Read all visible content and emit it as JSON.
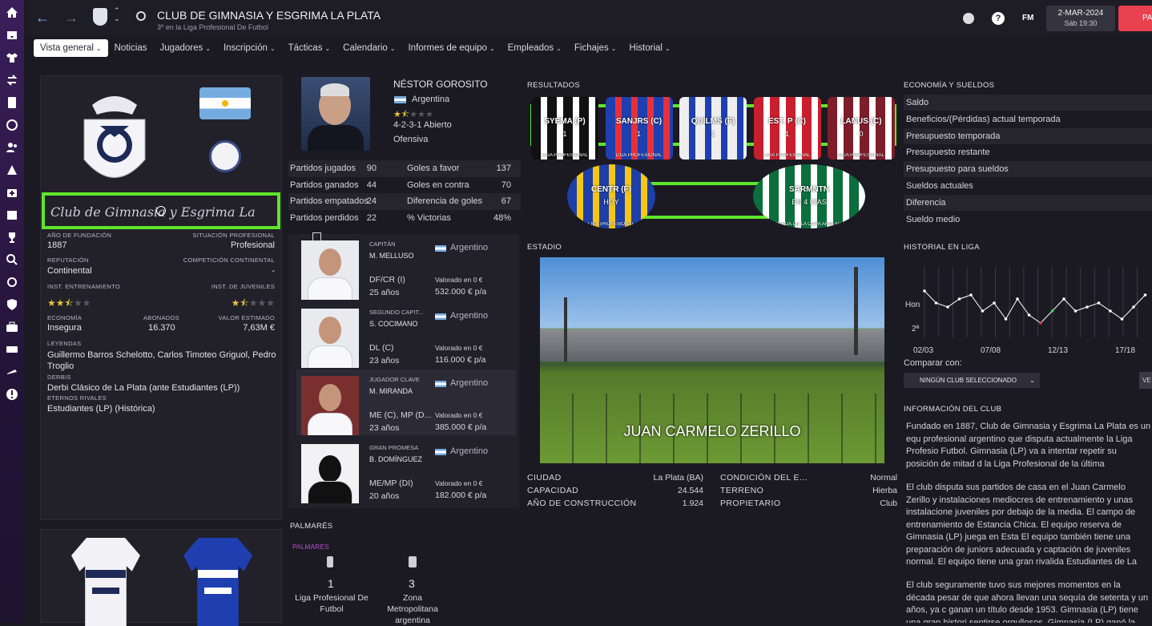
{
  "header": {
    "title": "CLUB DE GIMNASIA Y ESGRIMA LA PLATA",
    "subtitle": "3º en la Liga Profesional De Futbol",
    "date": "2-MAR-2024",
    "time": "Sáb 19:30",
    "fm_label": "FM",
    "continue_label": "PA"
  },
  "tabs": [
    {
      "label": "Vista general",
      "active": true
    },
    {
      "label": "Noticias"
    },
    {
      "label": "Jugadores",
      "caret": true
    },
    {
      "label": "Inscripción",
      "caret": true
    },
    {
      "label": "Tácticas",
      "caret": true
    },
    {
      "label": "Calendario",
      "caret": true
    },
    {
      "label": "Informes de equipo",
      "caret": true
    },
    {
      "label": "Empleados",
      "caret": true
    },
    {
      "label": "Fichajes",
      "caret": true
    },
    {
      "label": "Historial",
      "caret": true
    }
  ],
  "club": {
    "name_script": "Club de Gimnasia y Esgrima La",
    "founded_label": "AÑO DE FUNDACIÓN",
    "founded": "1887",
    "status_label": "SITUACIÓN PROFESIONAL",
    "status": "Profesional",
    "reputation_label": "REPUTACIÓN",
    "reputation": "Continental",
    "continental_label": "COMPETICIÓN CONTINENTAL",
    "continental": "-",
    "training_label": "INST. ENTRENAMIENTO",
    "training_stars": 2.5,
    "youth_label": "INST. DE JUVENILES",
    "youth_stars": 1.5,
    "economy_label": "ECONOMÍA",
    "economy": "Insegura",
    "members_label": "ABONADOS",
    "members": "16.370",
    "value_label": "VALOR ESTIMADO",
    "value": "7,63M €",
    "legends_label": "LEYENDAS",
    "legends": "Guillermo Barros Schelotto, Carlos Timoteo Griguol, Pedro Troglio",
    "derbies_label": "DERBIS",
    "derbies": "Derbi Clásico de La Plata (ante Estudiantes (LP))",
    "rivals_label": "ETERNOS RIVALES",
    "rivals": "Estudiantes (LP) (Histórica)"
  },
  "manager": {
    "name": "NÉSTOR GOROSITO",
    "nation": "Argentina",
    "stars": 1.5,
    "formation": "4-2-3-1 Abierto",
    "style": "Ofensiva"
  },
  "stats": [
    [
      "Partidos jugados",
      "90",
      "Goles a favor",
      "137"
    ],
    [
      "Partidos ganados",
      "44",
      "Goles en contra",
      "70"
    ],
    [
      "Partidos empatados",
      "24",
      "Diferencia de goles",
      "67"
    ],
    [
      "Partidos perdidos",
      "22",
      "% Victorias",
      "48%"
    ]
  ],
  "players": [
    {
      "role": "CAPITÁN",
      "name": "M. MELLUSO",
      "nation": "Argentino",
      "pos": "DF/CR (I)",
      "age": "25 años",
      "value_label": "Valorado en 0 €",
      "wage": "532.000 € p/a"
    },
    {
      "role": "SEGUNDO CAPIT...",
      "name": "S. COCIMANO",
      "nation": "Argentino",
      "pos": "DL (C)",
      "age": "23 años",
      "value_label": "Valorado en 0 €",
      "wage": "116.000 € p/a"
    },
    {
      "role": "JUGADOR CLAVE",
      "name": "M. MIRANDA",
      "nation": "Argentino",
      "pos": "ME (C), MP (D...",
      "age": "23 años",
      "value_label": "Valorado en 0 €",
      "wage": "385.000 € p/a"
    },
    {
      "role": "GRAN PROMESA",
      "name": "B. DOMÍNGUEZ",
      "nation": "Argentino",
      "pos": "ME/MP (DI)",
      "age": "20 años",
      "value_label": "Valorado en 0 €",
      "wage": "182.000 € p/a"
    }
  ],
  "palmares": {
    "title": "PALMARÉS",
    "subtitle": "PALMARÉS",
    "items": [
      {
        "count": "1",
        "name": "Liga Profesional De Futbol"
      },
      {
        "count": "3",
        "name": "Zona Metropolitana argentina"
      }
    ]
  },
  "results": {
    "title": "RESULTADOS",
    "row1": [
      {
        "text": "SYEMA (P)",
        "score": "1",
        "comp": "LIGA PROFESIONAL"
      },
      {
        "text": "SANJRS (C)",
        "score": "1",
        "comp": "LIGA PROFESIONAL"
      },
      {
        "text": "QUILMS (F)",
        "score": "1",
        "comp": ""
      },
      {
        "text": "EST. P (C)",
        "score": "1",
        "comp": "LIGA PROFESIONAL"
      },
      {
        "text": "LANUS (C)",
        "score": "0",
        "comp": "LIGA PROFESIONAL"
      }
    ],
    "row2": [
      {
        "text": "CENTR (F)",
        "score": "HOY",
        "comp": "LIGA PROFESIONAL"
      },
      {
        "text": "SARMNTN",
        "score": "EN 4 DÍAS",
        "comp": "5ª RONDA DE LA COPA ARGENTINA"
      }
    ]
  },
  "stadium": {
    "title": "ESTADIO",
    "name": "JUAN CARMELO ZERILLO",
    "city_label": "CIUDAD",
    "city": "La Plata (BA)",
    "capacity_label": "CAPACIDAD",
    "capacity": "24.544",
    "year_label": "AÑO DE CONSTRUCCIÓN",
    "year": "1.924",
    "condition_label": "CONDICIÓN DEL E...",
    "condition": "Normal",
    "pitch_label": "TERRENO",
    "pitch": "Hierba",
    "owner_label": "PROPIETARIO",
    "owner": "Club"
  },
  "finance": {
    "title": "ECONOMÍA Y SUELDOS",
    "rows": [
      "Saldo",
      "Beneficios/(Pérdidas) actual temporada",
      "Presupuesto temporada",
      "Presupuesto restante",
      "Presupuesto para sueldos",
      "Sueldos actuales",
      "Diferencia",
      "Sueldo medio"
    ]
  },
  "history": {
    "title": "HISTORIAL EN LIGA",
    "y_labels": [
      "Hon",
      "2ª"
    ],
    "x_labels": [
      "02/03",
      "07/08",
      "12/13",
      "17/18"
    ],
    "compare_label": "Comparar con:",
    "compare_select": "NINGÚN CLUB SELECCIONADO",
    "view_btn": "VE"
  },
  "chart_data": {
    "type": "line",
    "x": [
      "02/03",
      "03/04",
      "04/05",
      "05/06",
      "06/07",
      "07/08",
      "08/09",
      "09/10",
      "10/11",
      "11/12",
      "12/13",
      "13/14",
      "14/15",
      "15/16",
      "16/17",
      "17/18",
      "18/19",
      "19/20",
      "20/21",
      "21/22"
    ],
    "series": [
      {
        "values": [
          2,
          5,
          6,
          4,
          3,
          7,
          5,
          9,
          4,
          8,
          10,
          7,
          4,
          7,
          6,
          5,
          7,
          9,
          6,
          3
        ]
      }
    ],
    "y_labels": [
      "Hon",
      "2ª"
    ]
  },
  "info": {
    "title": "INFORMACIÓN DEL CLUB",
    "p1": "Fundado en 1887, Club de Gimnasia y Esgrima La Plata es un equ profesional argentino que disputa actualmente la Liga Profesio Futbol. Gimnasia (LP) va a intentar repetir su posición de mitad d la Liga Profesional de la última temporada.",
    "p2": "El club disputa sus partidos de casa en el Juan Carmelo Zerillo y instalaciones mediocres de entrenamiento y unas instalacione juveniles por debajo de la media. El campo de entrenamiento de Estancia Chica. El equipo reserva de Gimnasia (LP) juega en Esta El equipo también tiene una preparación de juniors adecuada y captación de juveniles normal. El equipo tiene una gran rivalida Estudiantes de La Plata.",
    "p3": "El club seguramente tuvo sus mejores momentos en la década pesar de que ahora llevan una sequía de setenta y un años, ya c ganan un título desde 1953. Gimnasia (LP) tiene una gran histori sentirse orgullosos. Gimnasia (LP) ganó la máxima división argen"
  }
}
